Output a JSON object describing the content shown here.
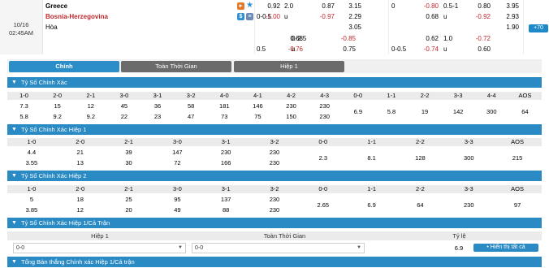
{
  "match": {
    "date": "10/16",
    "time": "02:45AM",
    "home": "Greece",
    "away": "Bosnia-Herzegovina",
    "draw": "Hòa",
    "row1": {
      "o1": "0.92",
      "o2": "2.0",
      "o3": "0.87",
      "o4": "3.15",
      "o5": "0",
      "o6": "-0.80",
      "o7": "0.5-1",
      "o8": "0.80",
      "o9": "3.95"
    },
    "row2": {
      "h": "0-0.5",
      "o1": "-1.00",
      "o2": "u",
      "o3": "-0.97",
      "o4": "2.29",
      "o6": "0.68",
      "o7": "u",
      "o8": "-0.92",
      "o9": "2.93"
    },
    "row3": {
      "o4": "3.05",
      "o9": "1.90"
    },
    "row4": {
      "o1": "0.68",
      "o2": "0-2.5",
      "o3": "-0.85",
      "o6": "0.62",
      "o7": "1.0",
      "o8": "-0.72"
    },
    "row5": {
      "h": "0.5",
      "o1": "-0.76",
      "o2": "u",
      "o3": "0.75",
      "h2": "0-0.5",
      "o6": "-0.74",
      "o7": "u",
      "o8": "0.60"
    },
    "more": "+70"
  },
  "tabs": [
    "Chính",
    "Toàn Thời Gian",
    "Hiệp 1"
  ],
  "sections": {
    "s1": {
      "title": "Tỷ Số Chính Xác",
      "cols": [
        "1-0",
        "2-0",
        "2-1",
        "3-0",
        "3-1",
        "3-2",
        "4-0",
        "4-1",
        "4-2",
        "4-3",
        "0-0",
        "1-1",
        "2-2",
        "3-3",
        "4-4",
        "AOS"
      ],
      "top": [
        "7.3",
        "15",
        "12",
        "45",
        "36",
        "58",
        "181",
        "146",
        "230",
        "230"
      ],
      "bottom": [
        "5.8",
        "9.2",
        "9.2",
        "22",
        "23",
        "47",
        "73",
        "75",
        "150",
        "230"
      ],
      "draws": [
        "6.9",
        "5.8",
        "19",
        "142",
        "300",
        "64"
      ]
    },
    "s2": {
      "title": "Tỷ Số Chính Xác Hiệp 1",
      "cols": [
        "1-0",
        "2-0",
        "2-1",
        "3-0",
        "3-1",
        "3-2",
        "0-0",
        "1-1",
        "2-2",
        "3-3",
        "AOS"
      ],
      "top": [
        "4.4",
        "21",
        "39",
        "147",
        "230",
        "230"
      ],
      "bottom": [
        "3.55",
        "13",
        "30",
        "72",
        "166",
        "230"
      ],
      "draws": [
        "2.3",
        "8.1",
        "128",
        "300",
        "215"
      ]
    },
    "s3": {
      "title": "Tỷ Số Chính Xác Hiệp 2",
      "cols": [
        "1-0",
        "2-0",
        "2-1",
        "3-0",
        "3-1",
        "3-2",
        "0-0",
        "1-1",
        "2-2",
        "3-3",
        "AOS"
      ],
      "top": [
        "5",
        "18",
        "25",
        "95",
        "137",
        "230"
      ],
      "bottom": [
        "3.85",
        "12",
        "20",
        "49",
        "88",
        "230"
      ],
      "draws": [
        "2.65",
        "6.9",
        "64",
        "230",
        "97"
      ]
    },
    "s4": {
      "title": "Tỷ Số Chính Xác Hiệp 1/Cả Trận",
      "cols": [
        "Hiệp 1",
        "Toàn Thời Gian",
        "Tỷ lệ"
      ],
      "half_value": "0-0",
      "full_value": "0-0",
      "rate": "6.9",
      "show_all": "• Hiển thị tất cả"
    },
    "s5": {
      "title": "Tổng Bàn thắng Chính xác Hiệp 1/Cả trận"
    }
  }
}
